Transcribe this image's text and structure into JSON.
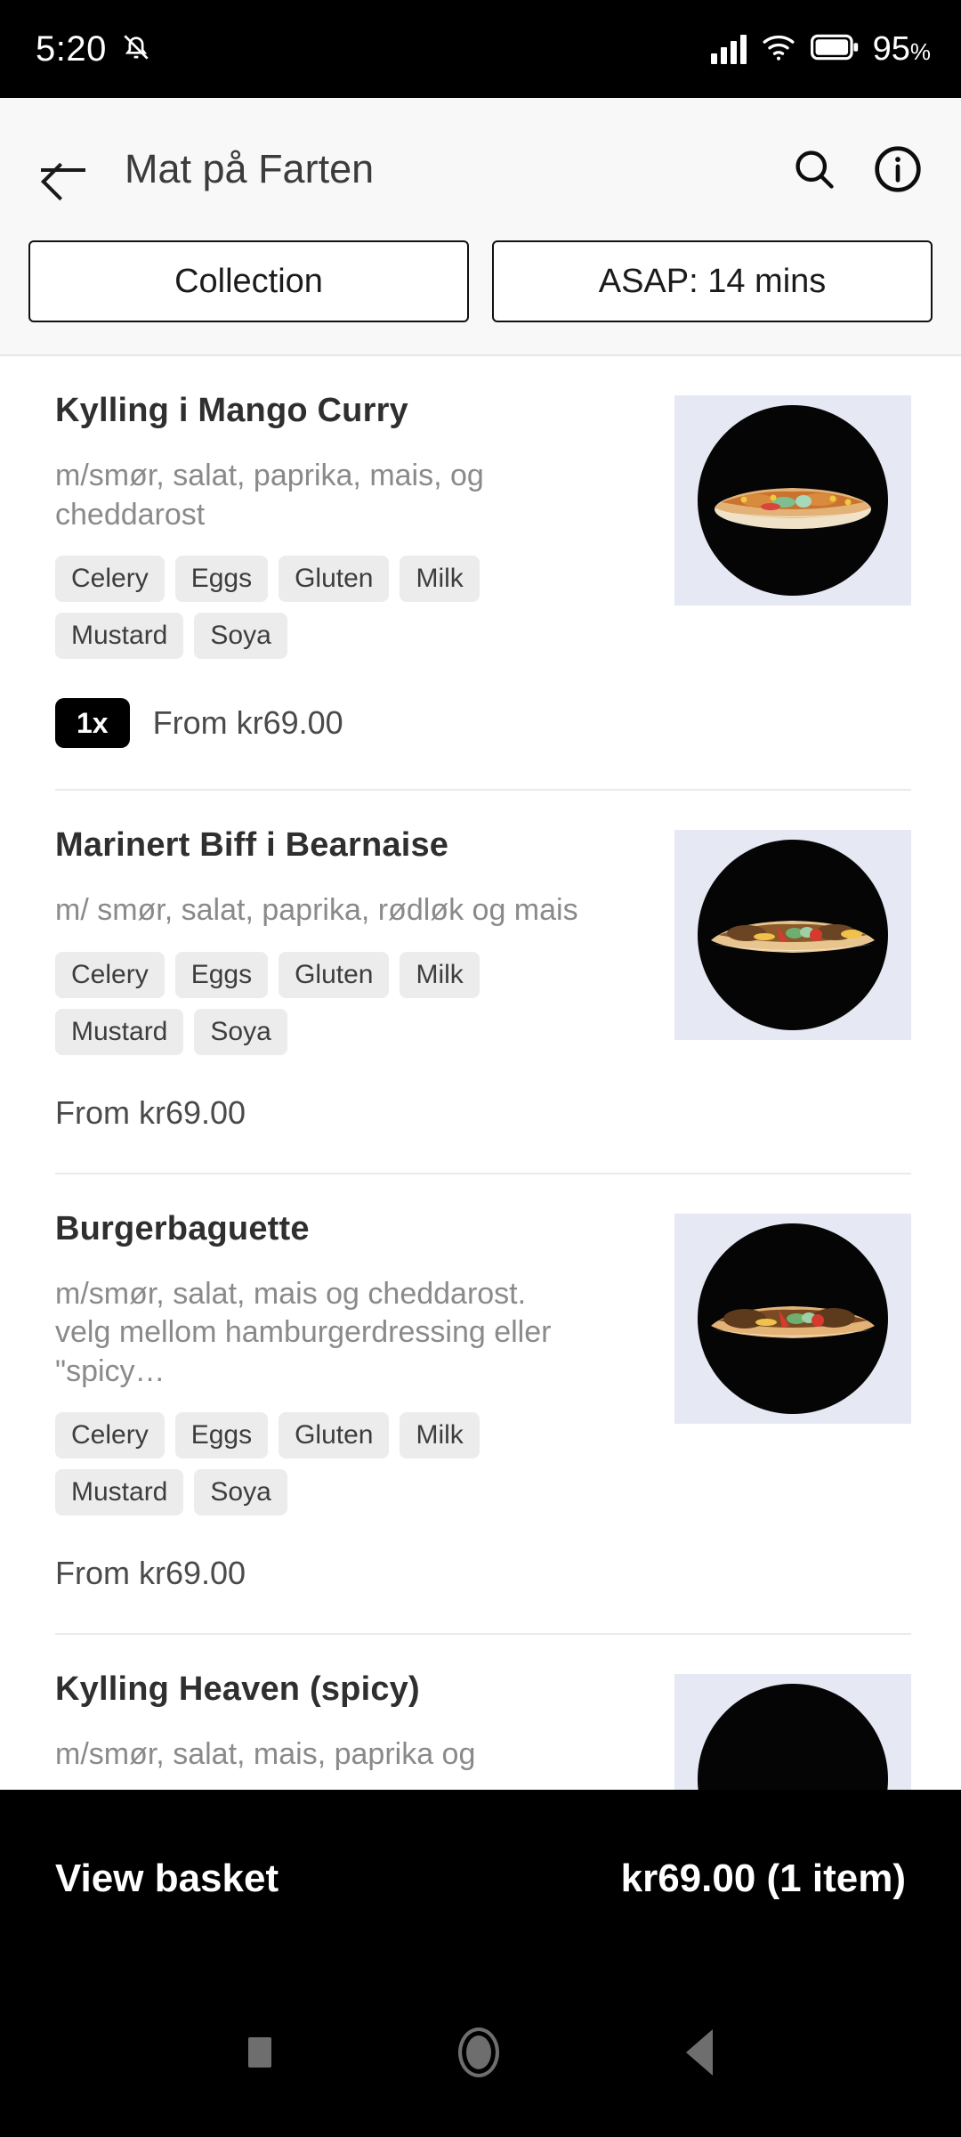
{
  "status_bar": {
    "time": "5:20",
    "mute_icon": "bell-muted-icon",
    "signal_icon": "cellular-signal-icon",
    "wifi_icon": "wifi-icon",
    "battery_icon": "battery-icon",
    "battery_level": "95",
    "battery_unit": "%"
  },
  "app_bar": {
    "back_label": "back-arrow",
    "title": "Mat på Farten",
    "search_icon": "search-icon",
    "info_icon": "info-icon"
  },
  "options": {
    "collection": "Collection",
    "timing": "ASAP: 14 mins"
  },
  "menu": {
    "items": [
      {
        "title": "Kylling i Mango Curry",
        "description": "m/smør, salat, paprika, mais, og cheddarost",
        "tags": [
          "Celery",
          "Eggs",
          "Gluten",
          "Milk",
          "Mustard",
          "Soya"
        ],
        "quantity": "1x",
        "price": "From  kr69.00",
        "image": "chicken-mango-curry-baguette-image"
      },
      {
        "title": "Marinert Biff i Bearnaise",
        "description": "m/ smør, salat, paprika, rødløk og mais",
        "tags": [
          "Celery",
          "Eggs",
          "Gluten",
          "Milk",
          "Mustard",
          "Soya"
        ],
        "quantity": "",
        "price": "From  kr69.00",
        "image": "marinated-beef-bearnaise-baguette-image"
      },
      {
        "title": "Burgerbaguette",
        "description": "m/smør, salat, mais og cheddarost. velg mellom hamburgerdressing eller \"spicy…",
        "tags": [
          "Celery",
          "Eggs",
          "Gluten",
          "Milk",
          "Mustard",
          "Soya"
        ],
        "quantity": "",
        "price": "From  kr69.00",
        "image": "burger-baguette-image"
      },
      {
        "title": "Kylling Heaven (spicy)",
        "description": "m/smør, salat, mais, paprika og",
        "tags": [],
        "quantity": "",
        "price": "",
        "image": "chicken-heaven-spicy-baguette-image"
      }
    ]
  },
  "basket": {
    "label": "View basket",
    "total": "kr69.00 (1 item)"
  },
  "nav_bar": {
    "recents_icon": "square-recents-icon",
    "home_icon": "circle-home-icon",
    "back_icon": "triangle-back-icon"
  },
  "colors": {
    "accent_black": "#000000",
    "header_bg": "#f8f8f8",
    "tag_bg": "#ececec",
    "thumb_bg": "#e6e8f3"
  }
}
